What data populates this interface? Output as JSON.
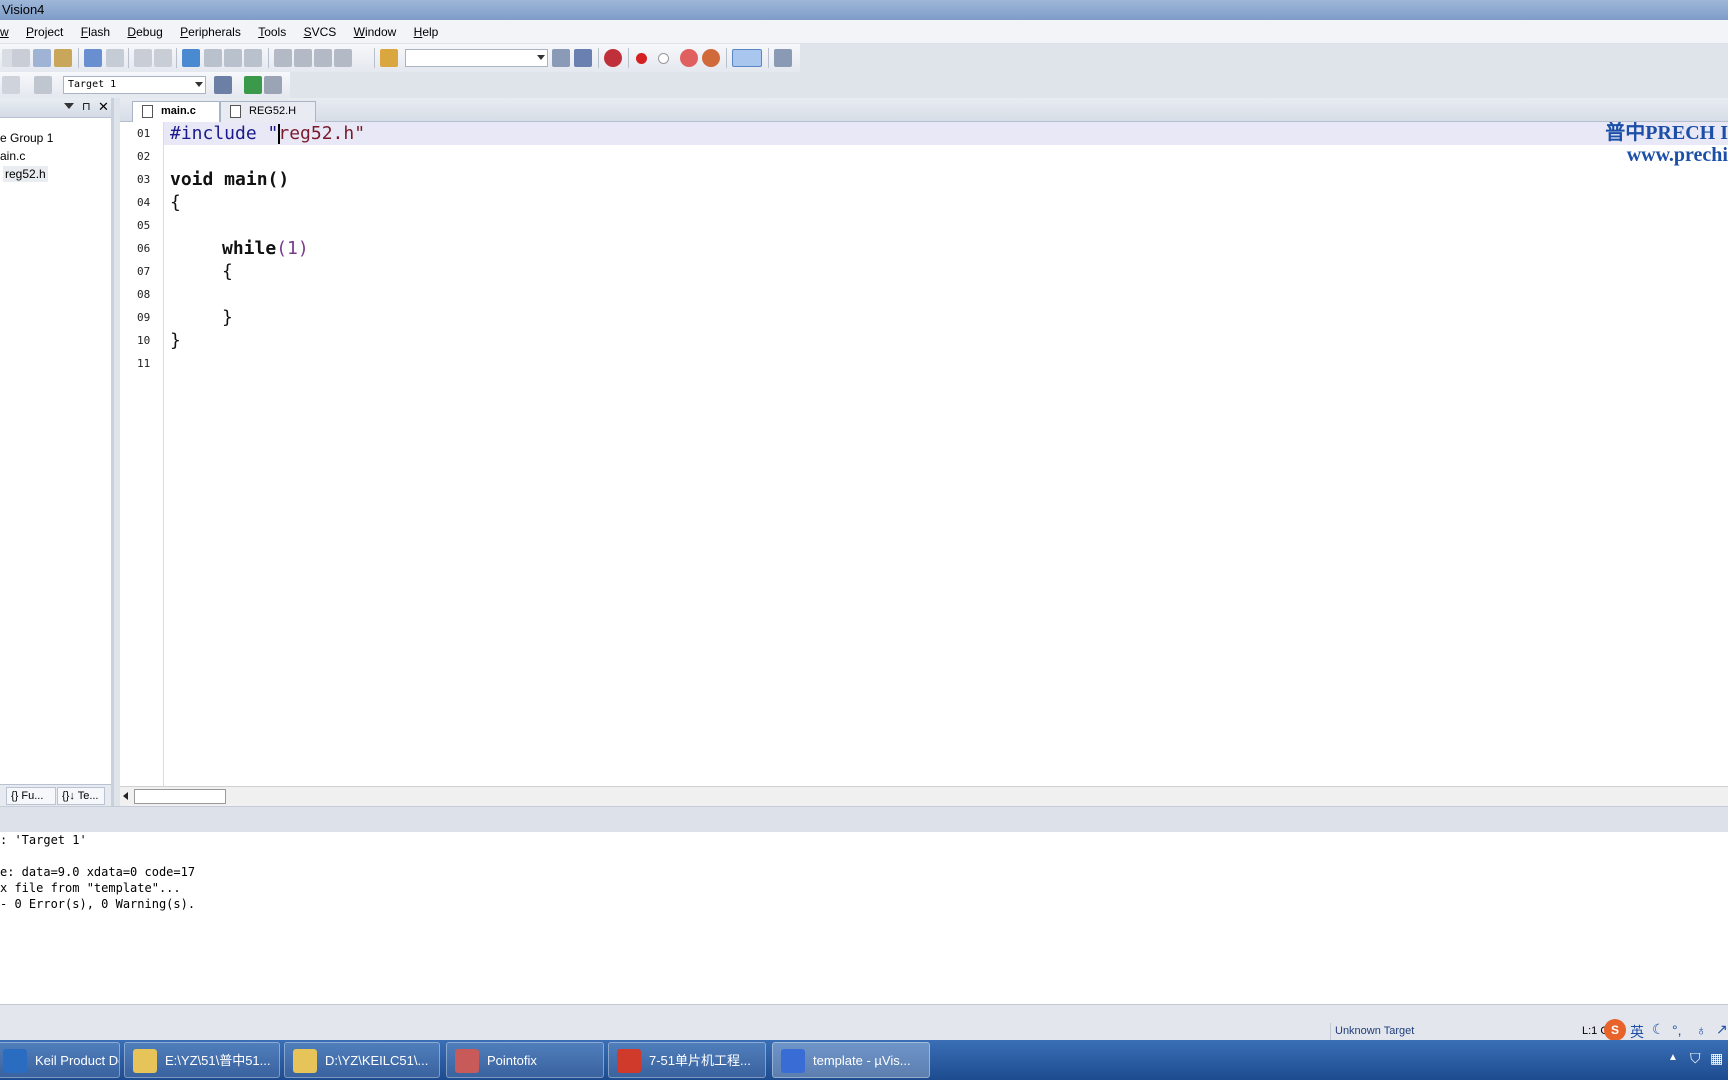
{
  "window": {
    "title": "Vision4"
  },
  "menu": [
    "w",
    "Project",
    "Flash",
    "Debug",
    "Peripherals",
    "Tools",
    "SVCS",
    "Window",
    "Help"
  ],
  "toolbar": {
    "target": "Target 1"
  },
  "project": {
    "items": [
      "e Group 1",
      "ain.c",
      "reg52.h"
    ],
    "tabs": [
      "{} Fu...",
      "{}↓ Te..."
    ]
  },
  "editor": {
    "tabs": [
      "main.c",
      "REG52.H"
    ],
    "line_numbers": [
      "01",
      "02",
      "03",
      "04",
      "05",
      "06",
      "07",
      "08",
      "09",
      "10",
      "11"
    ],
    "code": {
      "l1_pp": "#include \"",
      "l1_str": "reg52.h\"",
      "l3": "void main()",
      "l4": "{",
      "l6_kw": "while",
      "l6_rest": "(1)",
      "l7": "{",
      "l9": "}",
      "l10": "}"
    },
    "watermark": {
      "line1": "普中PRECH I",
      "line2": "www.prechi"
    }
  },
  "output": {
    "lines": [
      ": 'Target 1'",
      "",
      "e: data=9.0 xdata=0 code=17",
      "x file from \"template\"...",
      "- 0 Error(s), 0 Warning(s)."
    ]
  },
  "status": {
    "target": "Unknown Target",
    "pos": "L:1 C"
  },
  "taskbar": {
    "items": [
      {
        "label": "Keil Product Do...",
        "color": "#2a6cc0"
      },
      {
        "label": "E:\\YZ\\51\\普中51...",
        "color": "#e7c45a"
      },
      {
        "label": "D:\\YZ\\KEILC51\\...",
        "color": "#e7c45a"
      },
      {
        "label": "Pointofix",
        "color": "#c85a5a"
      },
      {
        "label": "7-51单片机工程...",
        "color": "#d03a2a"
      },
      {
        "label": "template  - µVis...",
        "color": "#3a6cd6"
      }
    ]
  },
  "colors": {
    "accent": "#1c4fa8",
    "highlight_line": "#e8e8f6"
  }
}
